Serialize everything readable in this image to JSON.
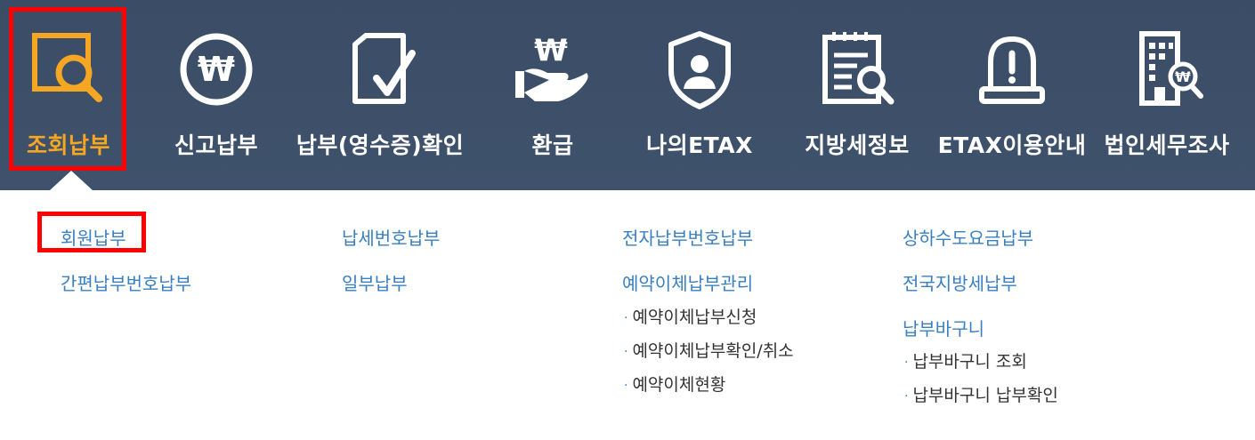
{
  "nav": {
    "items": [
      {
        "label": "조회납부",
        "icon": "search-document-icon",
        "active": true
      },
      {
        "label": "신고납부",
        "icon": "won-circle-icon"
      },
      {
        "label": "납부(영수증)확인",
        "icon": "document-check-icon"
      },
      {
        "label": "환급",
        "icon": "hand-won-icon"
      },
      {
        "label": "나의ETAX",
        "icon": "user-shield-icon"
      },
      {
        "label": "지방세정보",
        "icon": "document-search-icon"
      },
      {
        "label": "ETAX이용안내",
        "icon": "alarm-icon"
      },
      {
        "label": "법인세무조사",
        "icon": "building-won-icon"
      }
    ]
  },
  "submenu": {
    "col1": {
      "link1": "회원납부",
      "link2": "간편납부번호납부"
    },
    "col2": {
      "link1": "납세번호납부",
      "link2": "일부납부"
    },
    "col3": {
      "link1": "전자납부번호납부",
      "link2": "예약이체납부관리",
      "sub": [
        "예약이체납부신청",
        "예약이체납부확인/취소",
        "예약이체현황"
      ]
    },
    "col4": {
      "link1": "상하수도요금납부",
      "link2": "전국지방세납부",
      "link3": "납부바구니",
      "sub": [
        "납부바구니 조회",
        "납부바구니 납부확인"
      ]
    }
  },
  "colors": {
    "accent": "#f5a623",
    "highlight": "#ff0000",
    "link": "#3a7fc1",
    "nav_bg": "#3d4f68"
  }
}
